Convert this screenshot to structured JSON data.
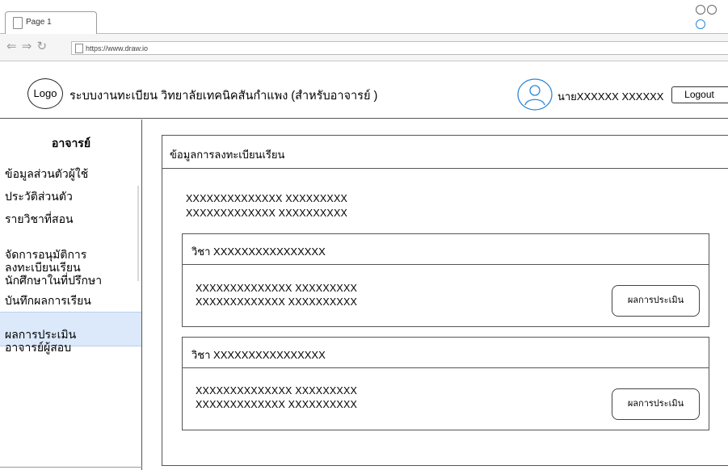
{
  "browser": {
    "tab_label": "Page 1",
    "url": "https://www.draw.io",
    "nav_icons": "⇐ ⇒ ↻"
  },
  "header": {
    "logo": "Logo",
    "title": "ระบบงานทะเบียน วิทยาลัยเทคนิคสันกำแพง (สำหรับอาจารย์ )",
    "user_name": "นายXXXXXX XXXXXX",
    "logout_label": "Logout"
  },
  "sidebar": {
    "title": "อาจารย์",
    "items": [
      {
        "label": "ข้อมูลส่วนตัวผู้ใช้"
      },
      {
        "label": "ประวัติส่วนตัว"
      },
      {
        "label": "รายวิชาที่สอน"
      },
      {
        "label": "จัดการอนุมัติการ\nลงทะเบียนเรียน"
      },
      {
        "label": "นักศึกษาในที่ปรึกษา"
      },
      {
        "label": "บันทึกผลการเรียน"
      },
      {
        "label": "ผลการประเมิน\nอาจารย์ผู้สอบ",
        "active": true
      }
    ]
  },
  "main": {
    "title": "ข้อมูลการลงทะเบียนเรียน",
    "info_line1": "XXXXXXXXXXXXXX  XXXXXXXXX",
    "info_line2": "XXXXXXXXXXXXX  XXXXXXXXXX",
    "courses": [
      {
        "title": "วิชา XXXXXXXXXXXXXXXX",
        "line1": "XXXXXXXXXXXXXX  XXXXXXXXX",
        "line2": "XXXXXXXXXXXXX  XXXXXXXXXX",
        "button_label": "ผลการประเมิน"
      },
      {
        "title": "วิชา XXXXXXXXXXXXXXXX",
        "line1": "XXXXXXXXXXXXXX  XXXXXXXXX",
        "line2": "XXXXXXXXXXXXX  XXXXXXXXXX",
        "button_label": "ผลการประเมิน"
      }
    ]
  },
  "colors": {
    "active_item_bg": "#dbe9fb",
    "avatar_stroke": "#2e86d6"
  }
}
